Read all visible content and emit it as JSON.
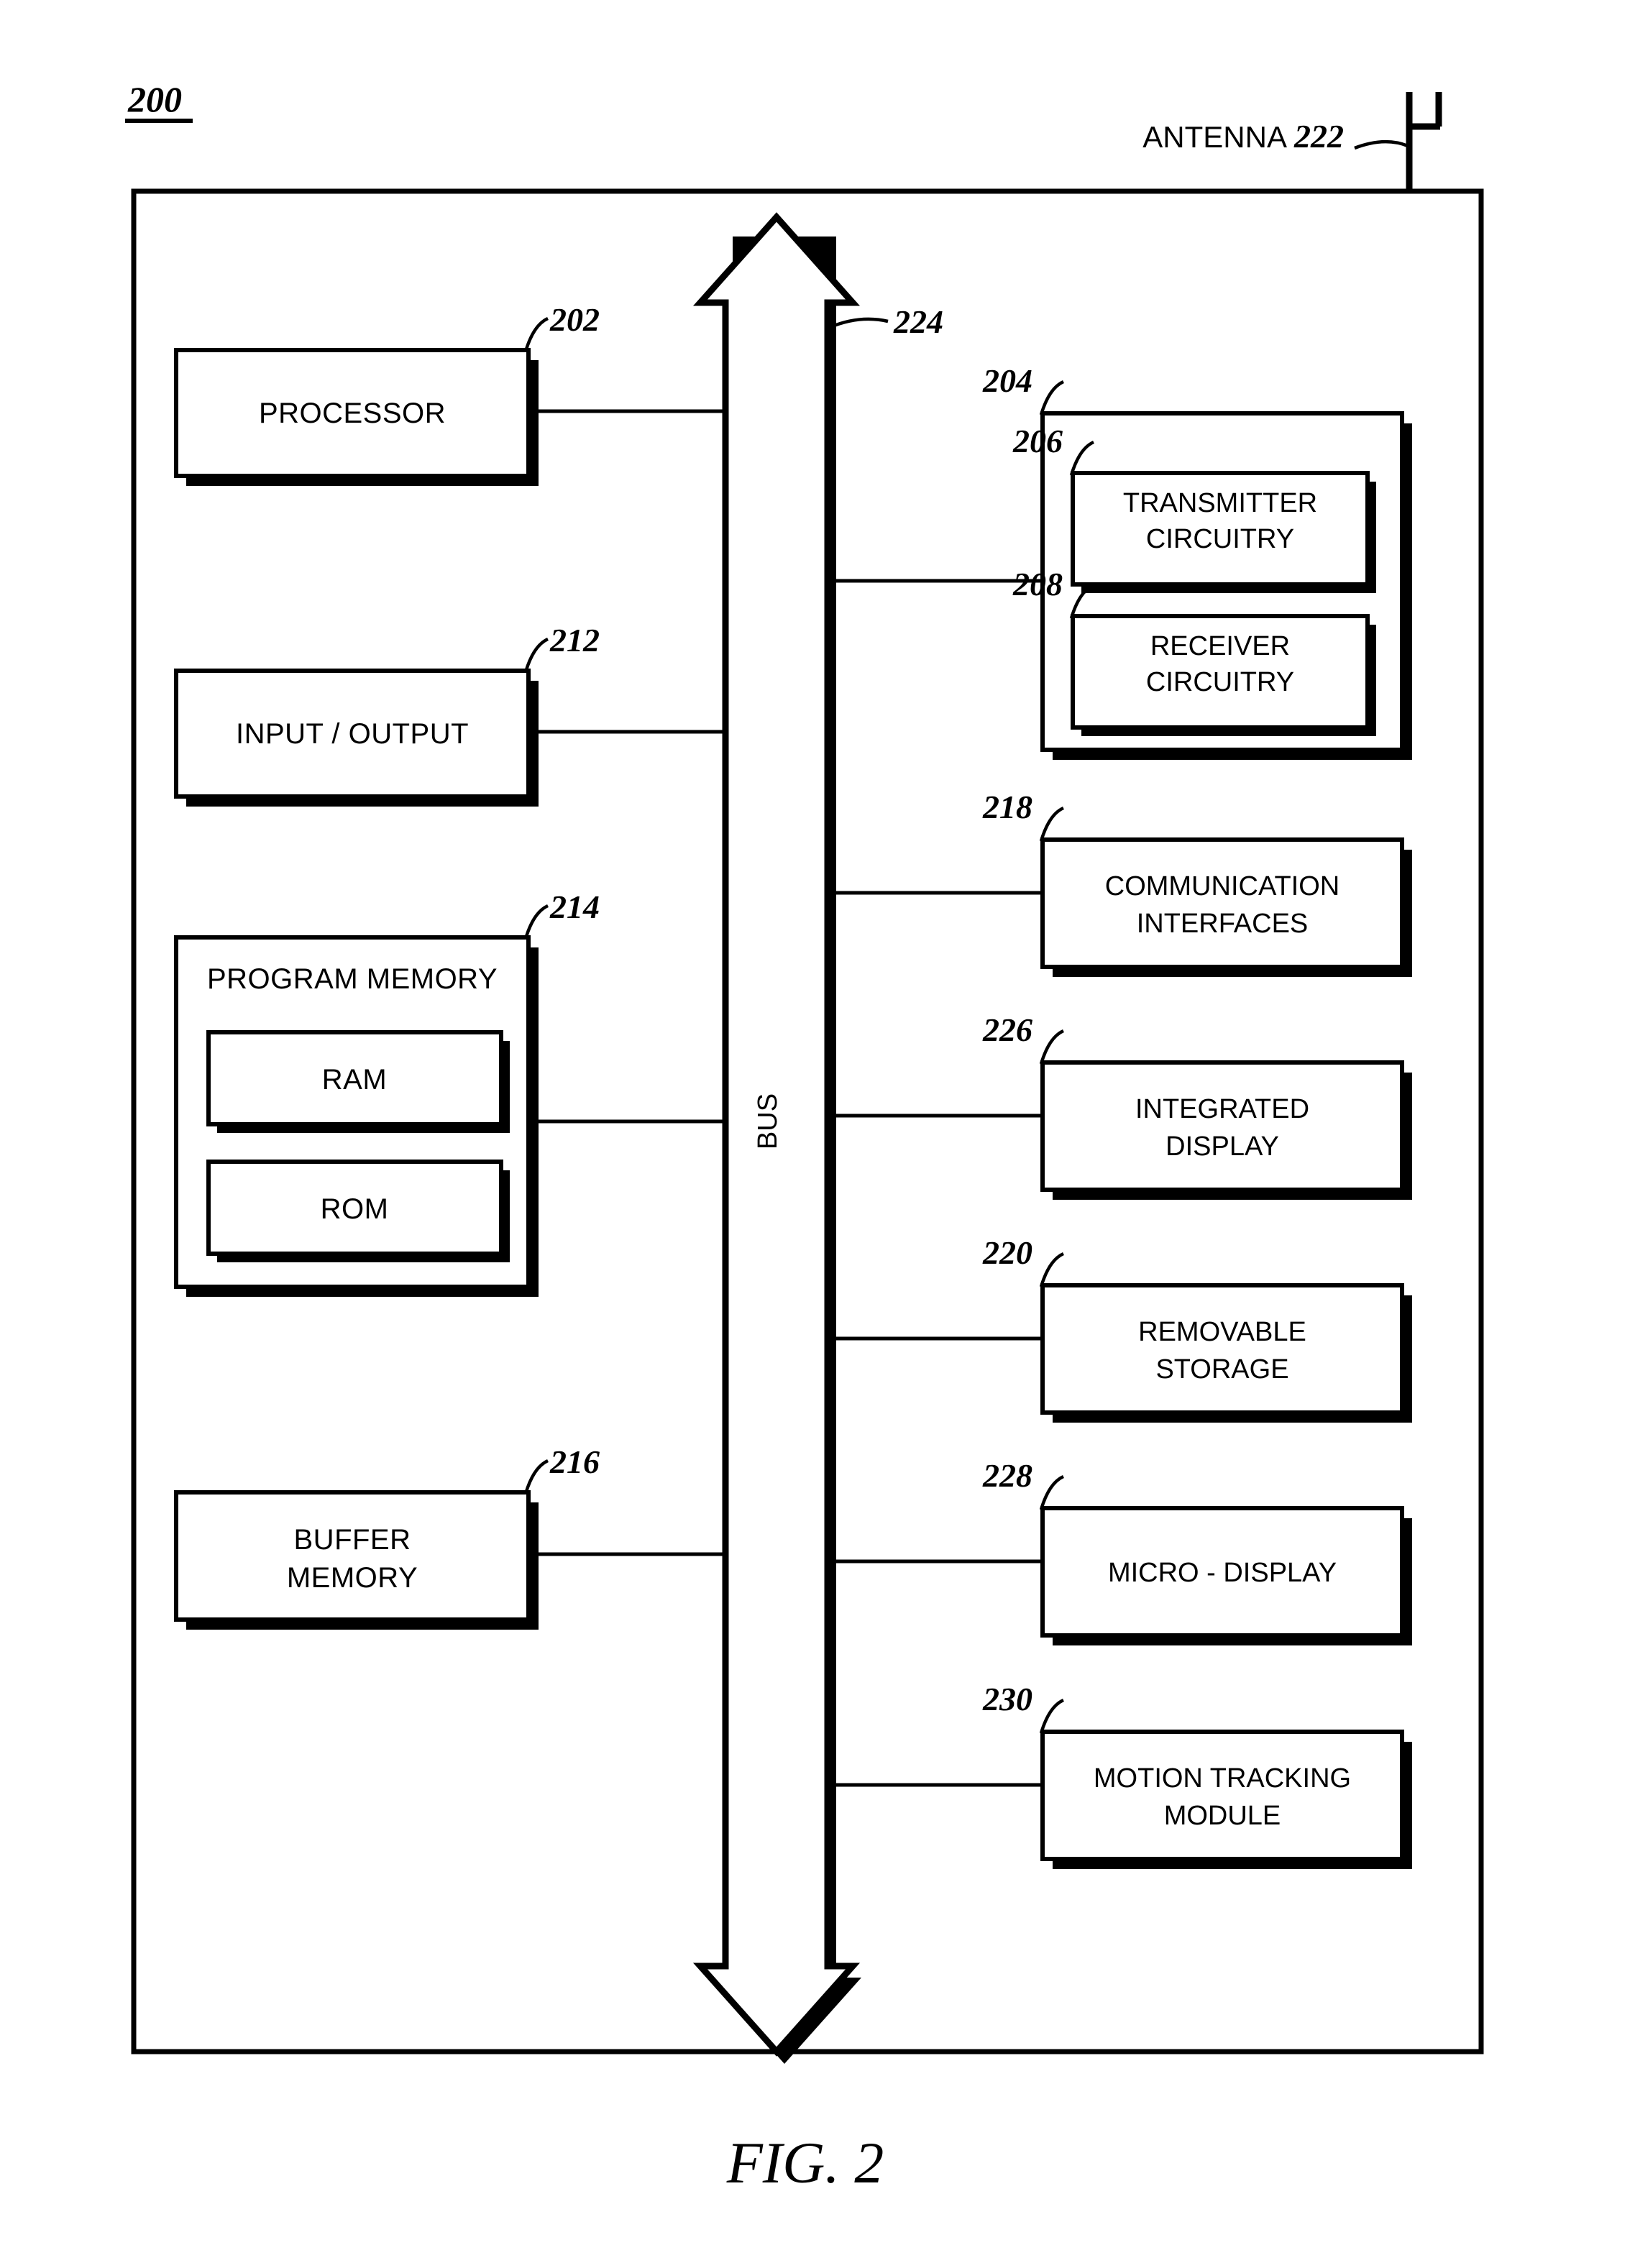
{
  "figure": {
    "figure_number": "200",
    "caption": "FIG. 2",
    "antenna": {
      "label": "ANTENNA",
      "ref": "222"
    },
    "bus": {
      "label": "BUS",
      "ref": "224"
    },
    "left_blocks": [
      {
        "ref": "202",
        "label": "PROCESSOR"
      },
      {
        "ref": "212",
        "label": "INPUT / OUTPUT"
      },
      {
        "ref": "214",
        "label": "PROGRAM MEMORY",
        "children": [
          {
            "label": "RAM"
          },
          {
            "label": "ROM"
          }
        ]
      },
      {
        "ref": "216",
        "label_line1": "BUFFER",
        "label_line2": "MEMORY"
      }
    ],
    "right_blocks": [
      {
        "ref": "204",
        "label": "",
        "children": [
          {
            "ref": "206",
            "label_line1": "TRANSMITTER",
            "label_line2": "CIRCUITRY"
          },
          {
            "ref": "208",
            "label_line1": "RECEIVER",
            "label_line2": "CIRCUITRY"
          }
        ]
      },
      {
        "ref": "218",
        "label_line1": "COMMUNICATION",
        "label_line2": "INTERFACES"
      },
      {
        "ref": "226",
        "label_line1": "INTEGRATED",
        "label_line2": "DISPLAY"
      },
      {
        "ref": "220",
        "label_line1": "REMOVABLE",
        "label_line2": "STORAGE"
      },
      {
        "ref": "228",
        "label_line1": "MICRO - DISPLAY",
        "label_line2": ""
      },
      {
        "ref": "230",
        "label_line1": "MOTION TRACKING",
        "label_line2": "MODULE"
      }
    ],
    "colors": {
      "ink": "#000000",
      "paper": "#ffffff"
    }
  }
}
